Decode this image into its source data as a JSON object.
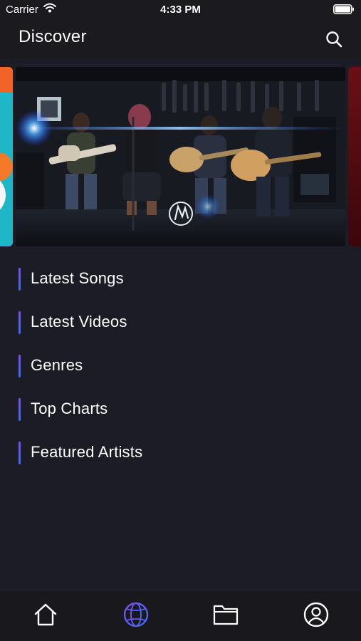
{
  "status_bar": {
    "carrier": "Carrier",
    "time": "4:33 PM"
  },
  "nav": {
    "title": "Discover"
  },
  "categories": [
    {
      "label": "Latest Songs"
    },
    {
      "label": "Latest Videos"
    },
    {
      "label": "Genres"
    },
    {
      "label": "Top Charts"
    },
    {
      "label": "Featured Artists"
    }
  ],
  "tabs": [
    {
      "icon": "home-icon",
      "active": false
    },
    {
      "icon": "globe-icon",
      "active": true
    },
    {
      "icon": "folder-icon",
      "active": false
    },
    {
      "icon": "profile-icon",
      "active": false
    }
  ],
  "colors": {
    "background": "#1b1c26",
    "accent_start": "#7b4ff0",
    "accent_end": "#3c6df0"
  }
}
